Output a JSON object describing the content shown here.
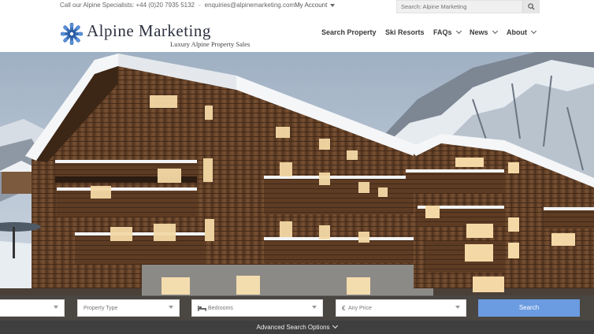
{
  "topbar": {
    "phone_text": "Call our Alpine Specialists: +44 (0)20 7935 5132",
    "separator": "-",
    "email": "enquiries@alpinemarketing.com",
    "account_label": "My Account",
    "search_placeholder": "Search: Alpine Marketing"
  },
  "header": {
    "brand": "Alpine Marketing",
    "tagline": "Luxury Alpine Property Sales",
    "nav": [
      {
        "label": "Search Property"
      },
      {
        "label": "Ski Resorts"
      },
      {
        "label": "FAQs"
      },
      {
        "label": "News"
      },
      {
        "label": "About"
      }
    ]
  },
  "search_form": {
    "property_type": "Property Type",
    "bedrooms": "Bedrooms",
    "price": "Any Price",
    "price_symbol": "€",
    "submit_label": "Search",
    "advanced_label": "Advanced Search Options"
  },
  "colors": {
    "brand_text": "#2d3140",
    "search_button": "#6b9be0",
    "advanced_bar": "#3f3f3f"
  },
  "icons": [
    "search-icon",
    "logo-snowflake-icon",
    "bed-icon",
    "chevron-down-icon"
  ]
}
